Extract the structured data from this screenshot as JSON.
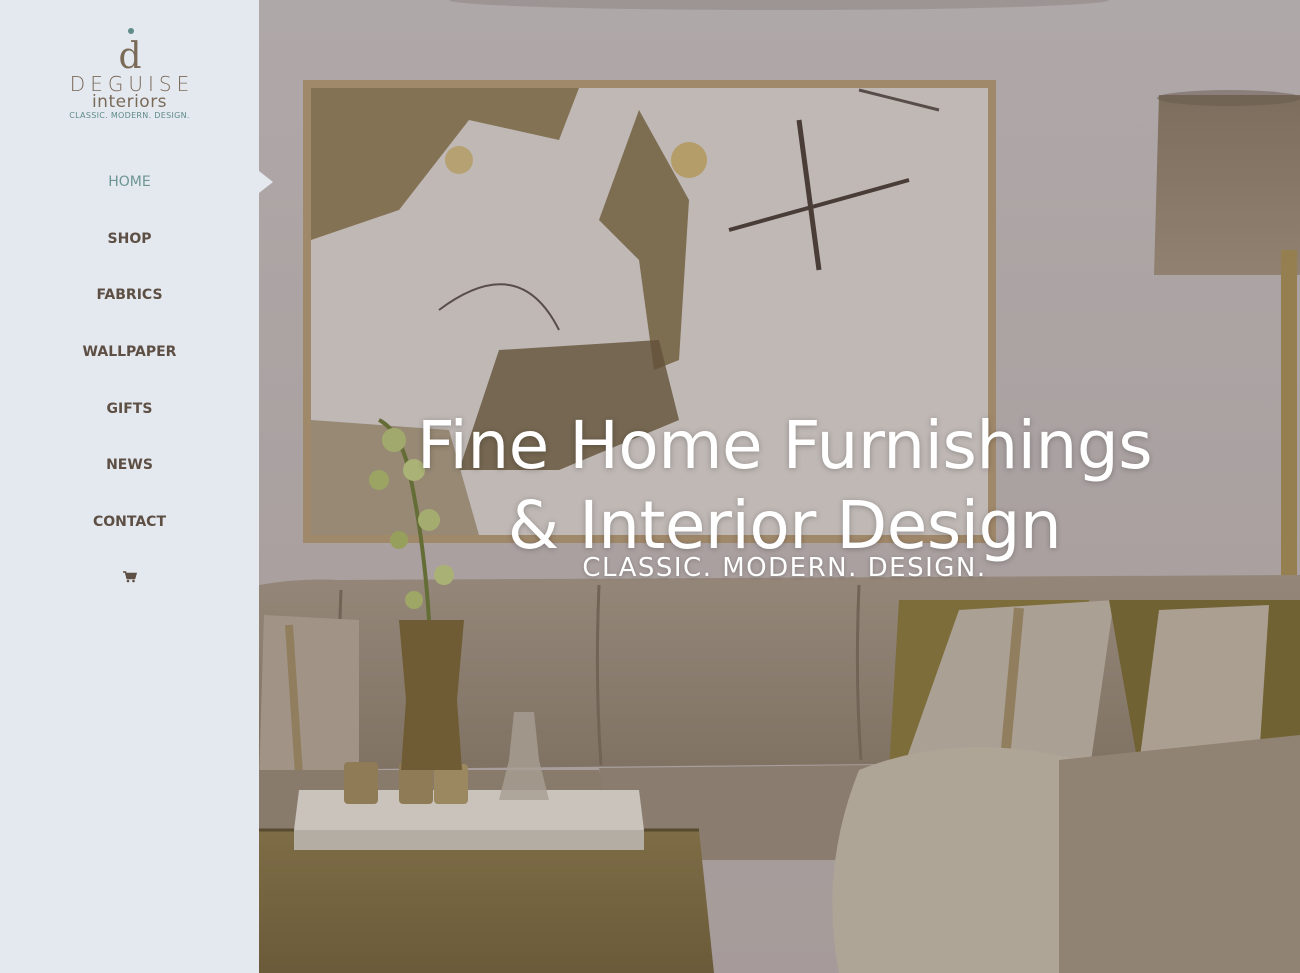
{
  "brand": {
    "mark": "d",
    "name": "DEGUISE",
    "sub": "interiors",
    "tagline": "CLASSIC. MODERN. DESIGN."
  },
  "nav": {
    "items": [
      {
        "label": "HOME",
        "active": true
      },
      {
        "label": "SHOP",
        "active": false
      },
      {
        "label": "FABRICS",
        "active": false
      },
      {
        "label": "WALLPAPER",
        "active": false
      },
      {
        "label": "GIFTS",
        "active": false
      },
      {
        "label": "NEWS",
        "active": false
      },
      {
        "label": "CONTACT",
        "active": false
      }
    ],
    "cart_icon": "shopping-cart-icon"
  },
  "hero": {
    "title_line1": "Fine Home Furnishings",
    "title_line2": "& Interior Design",
    "tagline": "CLASSIC. MODERN. DESIGN."
  },
  "colors": {
    "sidebar_bg": "#e4e8ef",
    "nav_text": "#5d4f44",
    "nav_active": "#6d9592",
    "brand_brown": "#7a6a58",
    "brand_teal": "#5f8b88"
  }
}
